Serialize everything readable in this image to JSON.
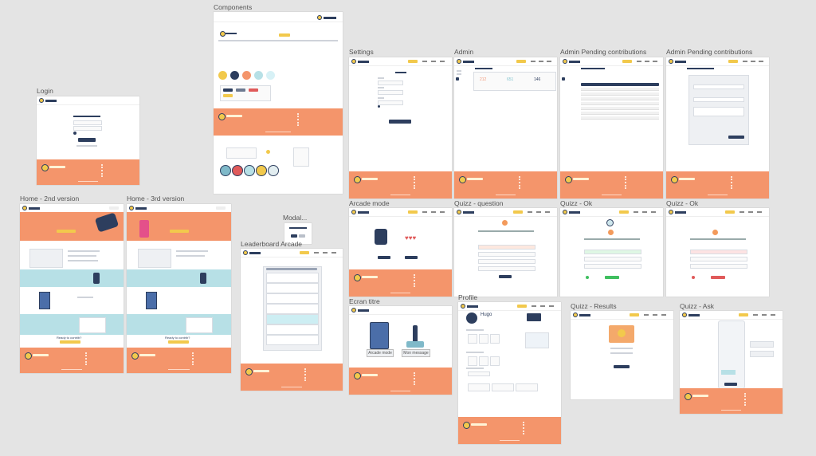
{
  "frames": {
    "components": "Components",
    "login": "Login",
    "settings": "Settings",
    "admin": "Admin",
    "admin_pending_1": "Admin Pending contributions",
    "admin_pending_2": "Admin Pending contributions",
    "home_v2": "Home - 2nd version",
    "home_v3": "Home - 3rd version",
    "modal": "Modal...",
    "leaderboard": "Leaderboard Arcade",
    "arcade_mode": "Arcade mode",
    "quizz_question": "Quizz - question",
    "quizz_ok_1": "Quizz - Ok",
    "quizz_ok_2": "Quizz - Ok",
    "ecran_titre": "Ecran titre",
    "profile": "Profile",
    "quizz_results": "Quizz - Results",
    "quizz_ask": "Quizz - Ask"
  },
  "content": {
    "profile_name": "Hugo",
    "ecran_arcade": "Arcade mode",
    "ecran_message": "Mon message",
    "home_ready": "Ready to contrib?",
    "admin_stats": [
      "212",
      "651",
      "146"
    ]
  },
  "colors": {
    "background": "#e4e4e4",
    "orange": "#f4956b",
    "navy": "#2d3e5e",
    "yellow": "#f2c94c",
    "teal": "#b7e0e6",
    "salmon": "#f39a7b"
  }
}
